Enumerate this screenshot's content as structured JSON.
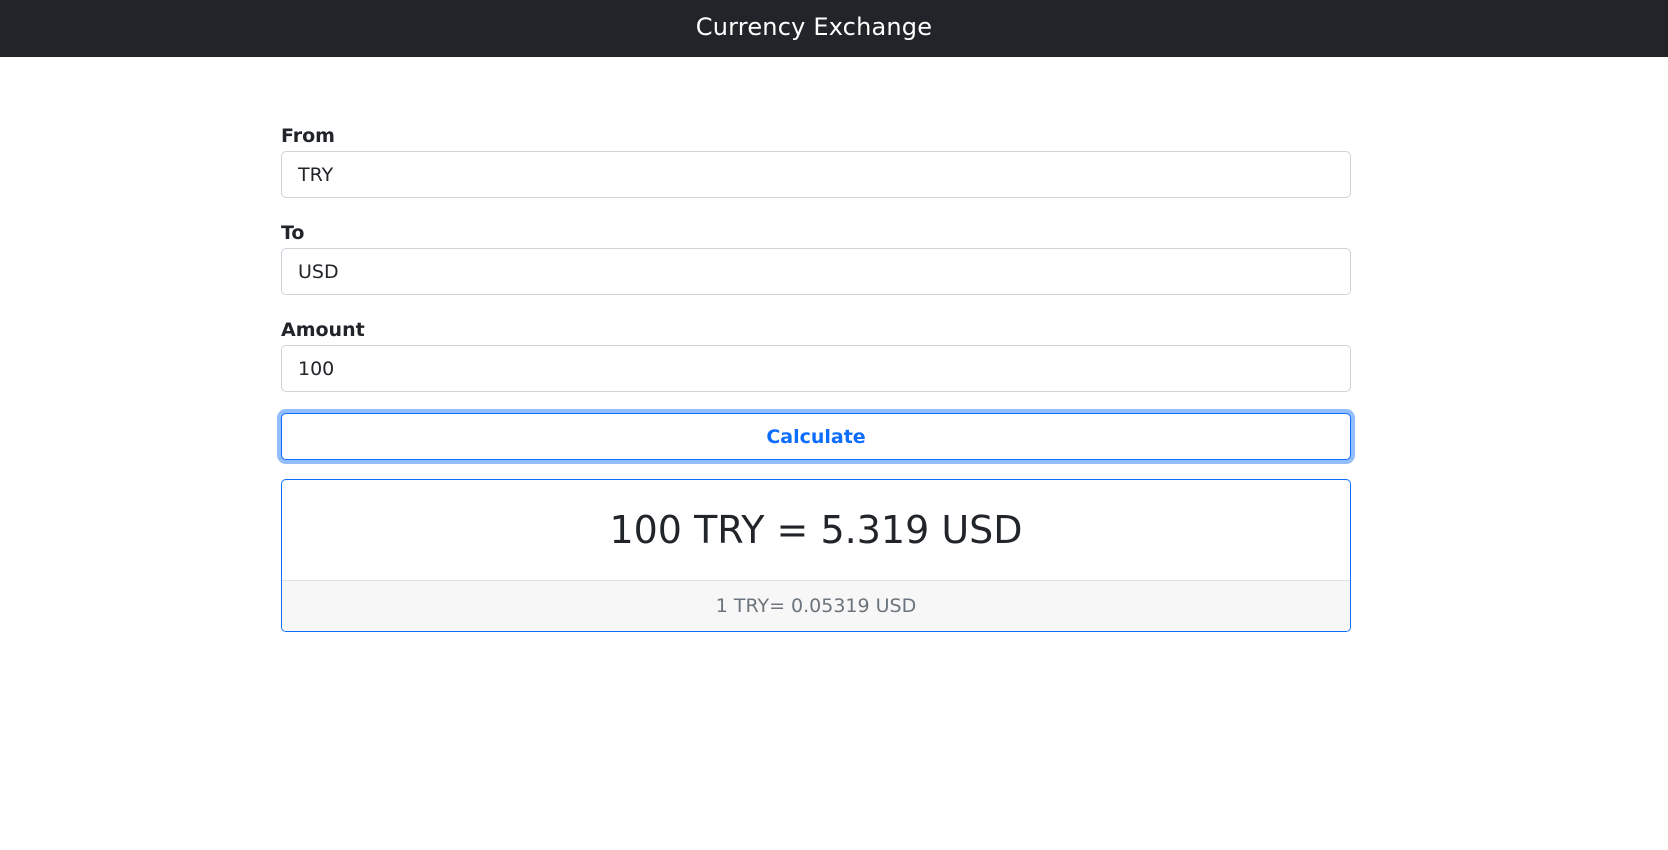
{
  "header": {
    "title": "Currency Exchange"
  },
  "form": {
    "from_label": "From",
    "from_value": "TRY",
    "to_label": "To",
    "to_value": "USD",
    "amount_label": "Amount",
    "amount_value": "100",
    "calculate_label": "Calculate"
  },
  "result": {
    "main_text": "100 TRY = 5.319 USD",
    "rate_text": "1 TRY= 0.05319 USD"
  },
  "colors": {
    "navbar": "#212529",
    "accent": "#0d6efd"
  }
}
